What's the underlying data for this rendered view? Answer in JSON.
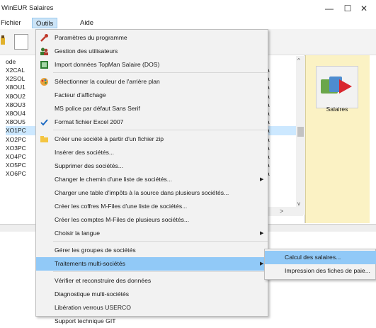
{
  "window": {
    "title": "WinEUR Salaires",
    "minimize": "—",
    "maximize": "☐",
    "close": "✕"
  },
  "menubar": {
    "items": [
      {
        "label": "Fichier"
      },
      {
        "label": "Outils"
      },
      {
        "label": "Aide"
      }
    ]
  },
  "list": {
    "header": "ode",
    "codes": [
      "X2CAL",
      "X2SOL",
      "X8OU1",
      "X8OU2",
      "X8OU3",
      "X8OU4",
      "X8OU5",
      "XO1PC",
      "XO2PC",
      "XO3PC",
      "XO4PC",
      "XO5PC",
      "XO6PC"
    ],
    "right_values": [
      "a",
      "a",
      "a",
      "a",
      "a",
      "a",
      "a",
      "a",
      "a",
      "a",
      "a",
      "a",
      "a"
    ],
    "selected_index": 7
  },
  "right_panel": {
    "tile_label": "Salaires"
  },
  "dropdown": {
    "items": [
      {
        "label": "Paramètres du programme",
        "icon": "wrench-icon"
      },
      {
        "label": "Gestion des utilisateurs",
        "icon": "users-icon"
      },
      {
        "label": "Import données TopMan Salaire (DOS)",
        "icon": "import-icon"
      },
      {
        "label": "Sélectionner la couleur de l'arrière plan",
        "icon": "palette-icon"
      },
      {
        "label": "Facteur d'affichage",
        "icon": ""
      },
      {
        "label": "MS police par défaut Sans Serif",
        "icon": ""
      },
      {
        "label": "Format fichier Excel 2007",
        "icon": "check-icon"
      },
      {
        "label": "Créer une société à partir d'un fichier zip",
        "icon": "folder-icon"
      },
      {
        "label": "Insérer des sociétés...",
        "icon": ""
      },
      {
        "label": "Supprimer des sociétés...",
        "icon": ""
      },
      {
        "label": "Changer le chemin d'une liste de sociétés...",
        "icon": "",
        "submenu": true
      },
      {
        "label": "Charger une table d'impôts à la source dans plusieurs sociétés...",
        "icon": ""
      },
      {
        "label": "Créer les coffres M-Files d'une liste de sociétés...",
        "icon": ""
      },
      {
        "label": "Créer les comptes M-Files de plusieurs sociétés...",
        "icon": ""
      },
      {
        "label": "Choisir la langue",
        "icon": "",
        "submenu": true
      },
      {
        "label": "Gérer les groupes de sociétés",
        "icon": ""
      },
      {
        "label": "Traitements multi-sociétés",
        "icon": "",
        "submenu": true,
        "highlighted": true
      },
      {
        "label": "Vérifier et reconstruire des données",
        "icon": ""
      },
      {
        "label": "Diagnostique multi-sociétés",
        "icon": ""
      },
      {
        "label": "Libération verrous USERCO",
        "icon": ""
      },
      {
        "label": "Support technique GIT",
        "icon": ""
      }
    ]
  },
  "submenu": {
    "items": [
      {
        "label": "Calcul des salaires...",
        "highlighted": true
      },
      {
        "label": "Impression des fiches de paie..."
      }
    ]
  },
  "colors": {
    "highlight": "#91c9f7",
    "menu_bg": "#f2f2f2",
    "panel_bg": "#fbf2c4",
    "selected_row": "#cce8ff"
  }
}
